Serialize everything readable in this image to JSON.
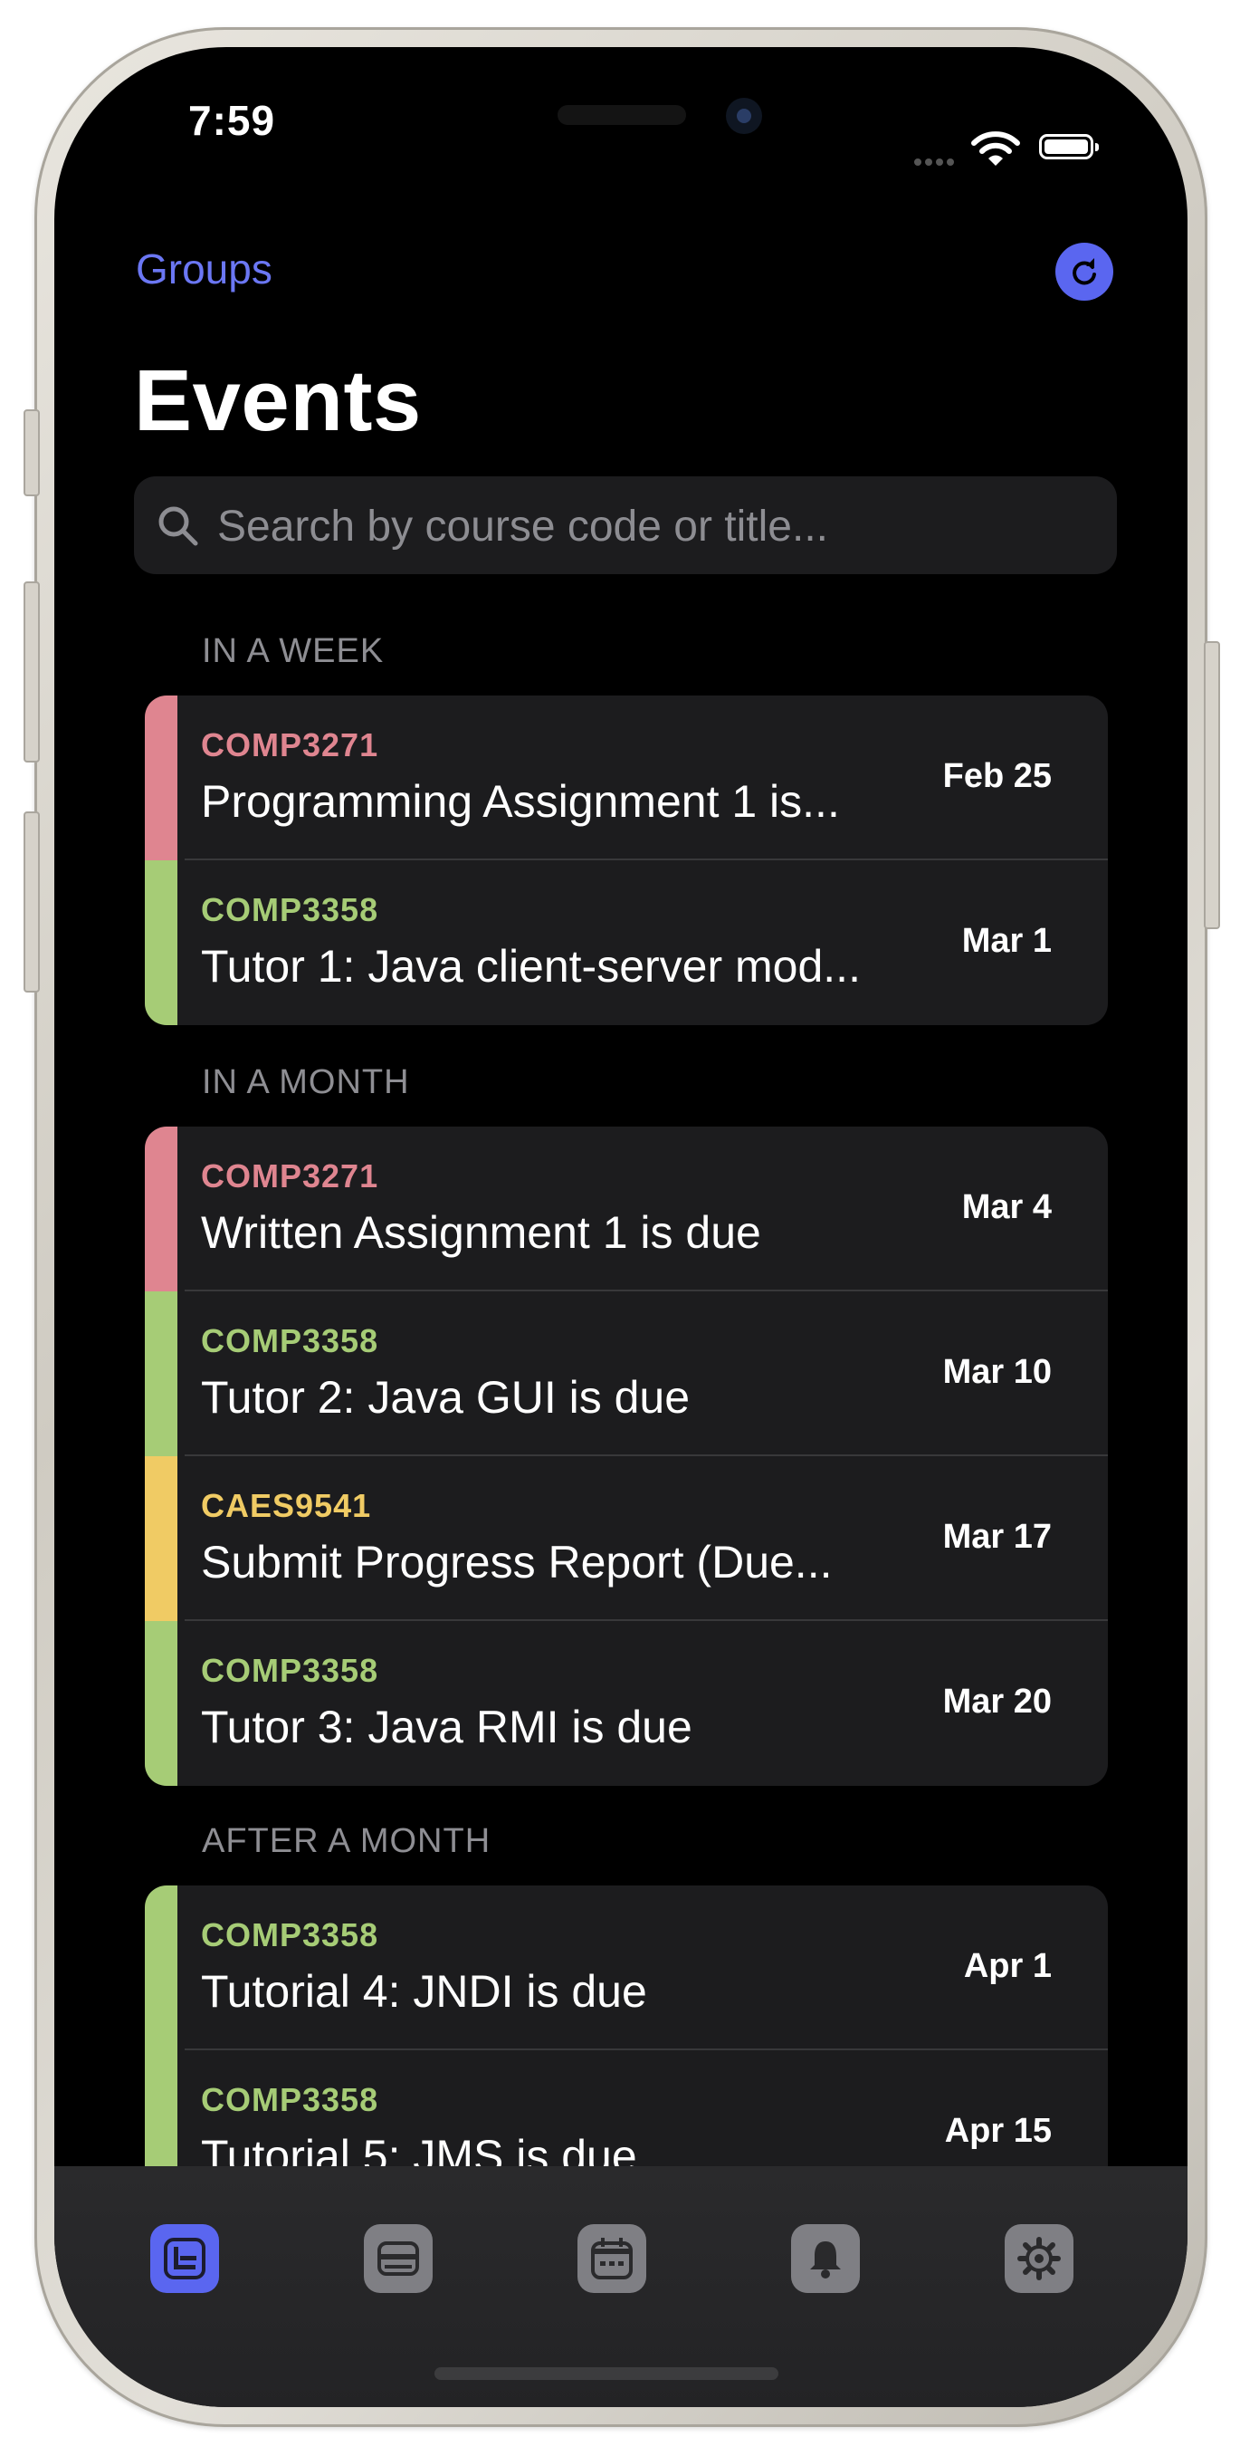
{
  "status_bar": {
    "time": "7:59"
  },
  "nav": {
    "back_label": "Groups"
  },
  "header": {
    "title": "Events"
  },
  "search": {
    "placeholder": "Search by course code or title..."
  },
  "colors": {
    "accent": "#6b77f4",
    "comp3271": "#df8590",
    "comp3358": "#a6cc76",
    "caes9541": "#f0cb64"
  },
  "sections": [
    {
      "header": "IN A WEEK",
      "events": [
        {
          "code": "COMP3271",
          "title": "Programming Assignment 1 is...",
          "date": "Feb 25"
        },
        {
          "code": "COMP3358",
          "title": "Tutor 1: Java client-server mod...",
          "date": "Mar 1"
        }
      ]
    },
    {
      "header": "IN A MONTH",
      "events": [
        {
          "code": "COMP3271",
          "title": "Written Assignment 1 is due",
          "date": "Mar 4"
        },
        {
          "code": "COMP3358",
          "title": "Tutor 2: Java GUI is due",
          "date": "Mar 10"
        },
        {
          "code": "CAES9541",
          "title": "Submit Progress Report (Due...",
          "date": "Mar 17"
        },
        {
          "code": "COMP3358",
          "title": "Tutor 3: Java RMI is due",
          "date": "Mar 20"
        }
      ]
    },
    {
      "header": "AFTER A MONTH",
      "events": [
        {
          "code": "COMP3358",
          "title": "Tutorial 4: JNDI is due",
          "date": "Apr 1"
        },
        {
          "code": "COMP3358",
          "title": "Tutorial 5: JMS is due",
          "date": "Apr 15"
        }
      ]
    }
  ],
  "tab_bar": {
    "tabs": [
      {
        "icon": "events-list-icon",
        "selected": true
      },
      {
        "icon": "card-icon",
        "selected": false
      },
      {
        "icon": "calendar-icon",
        "selected": false
      },
      {
        "icon": "bell-icon",
        "selected": false
      },
      {
        "icon": "gear-icon",
        "selected": false
      }
    ]
  }
}
